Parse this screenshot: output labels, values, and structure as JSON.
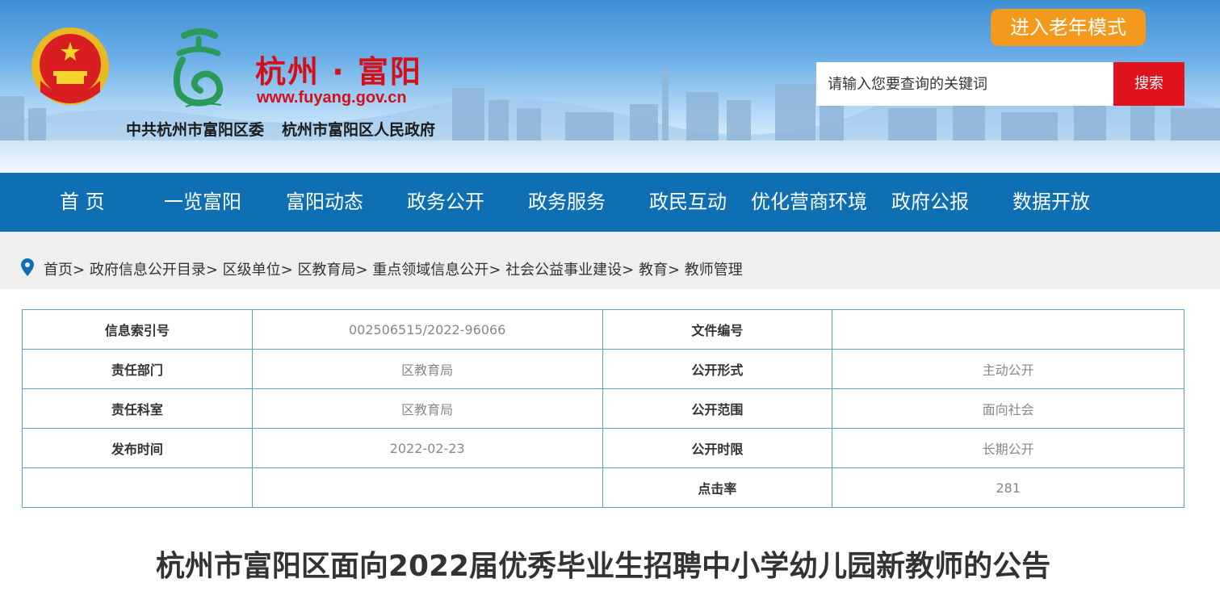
{
  "header": {
    "site_name": "杭州 · 富阳",
    "site_url": "www.fuyang.gov.cn",
    "org_1": "中共杭州市富阳区委",
    "org_2": "杭州市富阳区人民政府",
    "elder_mode_label": "进入老年模式",
    "search_placeholder": "请输入您要查询的关键词",
    "search_label": "搜索",
    "colors": {
      "brand_red": "#d3101a",
      "elder_orange": "#f39a1c",
      "search_red": "#e0121b"
    }
  },
  "nav": {
    "color": "#0e6fb2",
    "items": [
      {
        "label": "首 页"
      },
      {
        "label": "一览富阳"
      },
      {
        "label": "富阳动态"
      },
      {
        "label": "政务公开"
      },
      {
        "label": "政务服务"
      },
      {
        "label": "政民互动"
      },
      {
        "label": "优化营商环境"
      },
      {
        "label": "政府公报"
      },
      {
        "label": "数据开放"
      }
    ]
  },
  "breadcrumb": {
    "icon": "location-pin-icon",
    "items": [
      "首页",
      "政府信息公开目录",
      "区级单位",
      "区教育局",
      "重点领域信息公开",
      "社会公益事业建设",
      "教育",
      "教师管理"
    ],
    "separator": ">"
  },
  "meta_table": {
    "rows": [
      [
        "信息索引号",
        "002506515/2022-96066",
        "文件编号",
        ""
      ],
      [
        "责任部门",
        "区教育局",
        "公开形式",
        "主动公开"
      ],
      [
        "责任科室",
        "区教育局",
        "公开范围",
        "面向社会"
      ],
      [
        "发布时间",
        "2022-02-23",
        "公开时限",
        "长期公开"
      ],
      [
        "",
        "",
        "点击率",
        "281"
      ]
    ]
  },
  "article": {
    "title": "杭州市富阳区面向2022届优秀毕业生招聘中小学幼儿园新教师的公告"
  }
}
